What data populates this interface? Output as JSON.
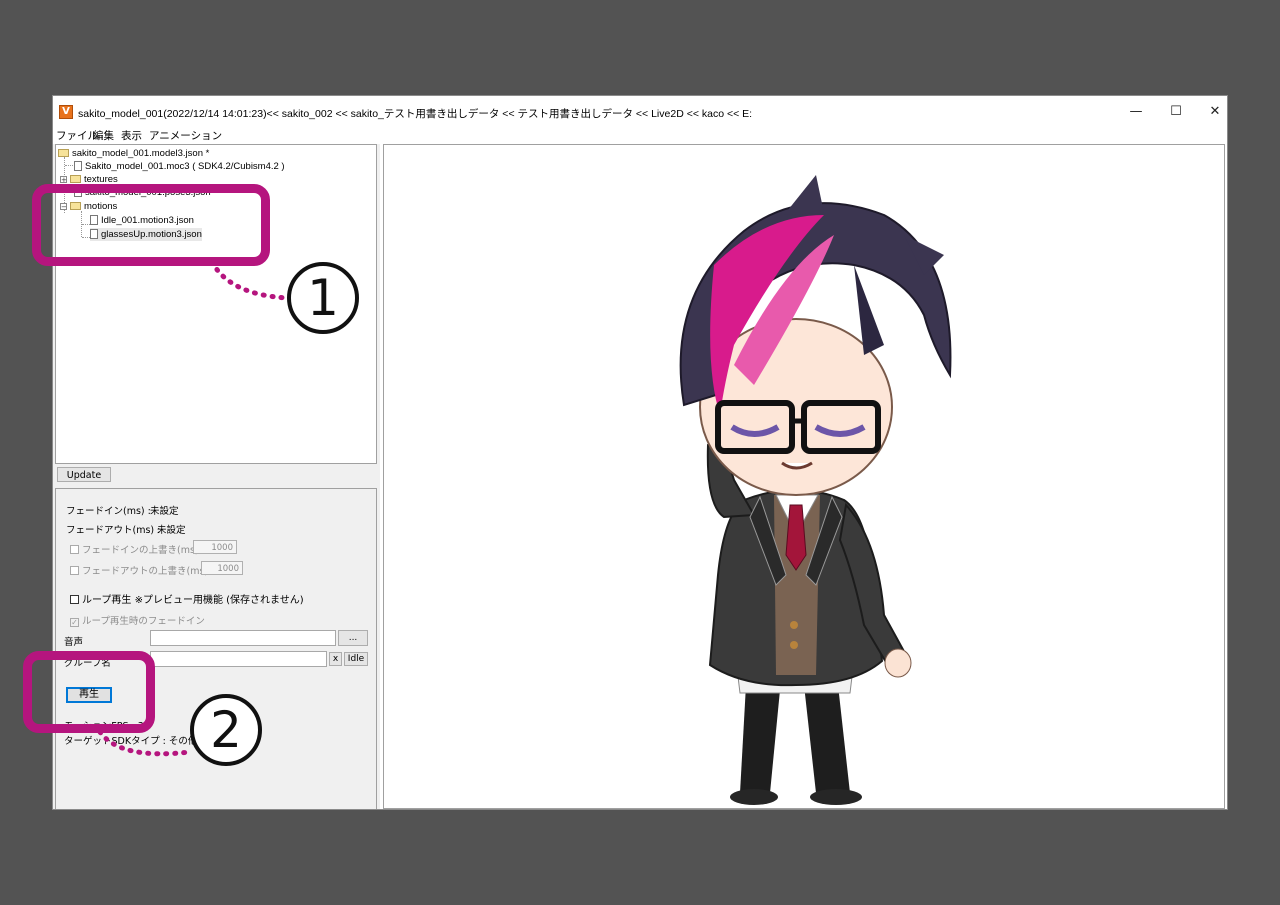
{
  "window": {
    "title": "sakito_model_001(2022/12/14 14:01:23)<< sakito_002 << sakito_テスト用書き出しデータ << テスト用書き出しデータ << Live2D << kaco << E:",
    "app_icon_letter": "V",
    "controls": {
      "minimize": "—",
      "maximize": "☐",
      "close": "✕"
    }
  },
  "menu": [
    "ファイル",
    "編集",
    "表示",
    "アニメーション"
  ],
  "tree": {
    "root": "sakito_model_001.model3.json *",
    "moc": "Sakito_model_001.moc3 ( SDK4.2/Cubism4.2 )",
    "textures": "textures",
    "pose": "sakito_model_001.pose3.json*",
    "motions": "motions",
    "motion_items": [
      "Idle_001.motion3.json",
      "glassesUp.motion3.json"
    ]
  },
  "update_label": "Update",
  "props": {
    "fade_in_label": "フェードイン(ms) :",
    "fade_in_value": "未設定",
    "fade_out_label": "フェードアウト(ms) :",
    "fade_out_value": "未設定",
    "override_fade_in": "フェードインの上書き(ms)",
    "override_fade_in_value": "1000",
    "override_fade_out": "フェードアウトの上書き(ms)",
    "override_fade_out_value": "1000",
    "loop_label": "ループ再生 ※プレビュー用機能 (保存されません)",
    "loop_fade_in": "ループ再生時のフェードイン",
    "audio_label": "音声",
    "browse_label": "...",
    "group_label": "グループ名",
    "clear_label": "x",
    "idle_label": "Idle",
    "play_label": "再生",
    "fps_label": "モーションFPS : 30",
    "target_sdk": "ターゲットSDKタイプ : その他"
  },
  "annotations": {
    "one": "1",
    "two": "2"
  },
  "colors": {
    "annotation": "#b5157e",
    "background": "#535353",
    "hair_main": "#3b3550",
    "hair_streak": "#d81b8c",
    "blazer": "#3a3a3a",
    "tie": "#a3153a"
  }
}
